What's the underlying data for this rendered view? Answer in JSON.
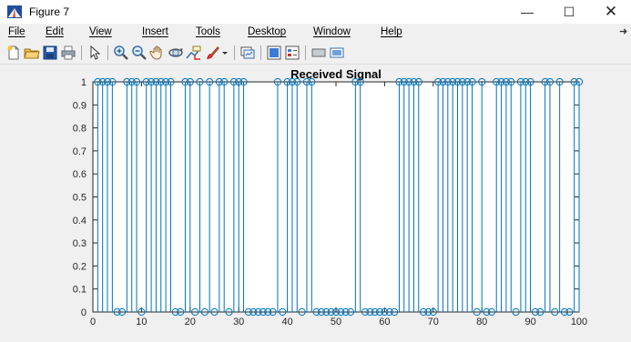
{
  "window": {
    "title": "Figure 7"
  },
  "controls": {
    "minimize": "—",
    "maximize": "☐",
    "close": "✕"
  },
  "menu": [
    "File",
    "Edit",
    "View",
    "Insert",
    "Tools",
    "Desktop",
    "Window",
    "Help"
  ],
  "toolbar": {
    "icons": [
      "new-figure-icon",
      "open-file-icon",
      "save-icon",
      "print-icon",
      "pointer-icon",
      "zoom-in-icon",
      "zoom-out-icon",
      "pan-icon",
      "rotate-3d-icon",
      "data-cursor-icon",
      "brush-icon",
      "brush-dropdown-icon",
      "link-plot-icon",
      "colorbar-icon",
      "legend-icon",
      "hide-plot-tools-icon",
      "show-plot-tools-icon"
    ]
  },
  "colors": {
    "stem": "#0072bd",
    "axes_bg": "#ffffff",
    "figure_bg": "#f0f0f0"
  },
  "chart_data": {
    "type": "stem",
    "title": "Received Signal",
    "xlabel": "",
    "ylabel": "",
    "xlim": [
      0,
      100
    ],
    "ylim": [
      0,
      1
    ],
    "xticks": [
      0,
      10,
      20,
      30,
      40,
      50,
      60,
      70,
      80,
      90,
      100
    ],
    "yticks": [
      0,
      0.1,
      0.2,
      0.3,
      0.4,
      0.5,
      0.6,
      0.7,
      0.8,
      0.9,
      1
    ],
    "grid": false,
    "x": [
      1,
      2,
      3,
      4,
      5,
      6,
      7,
      8,
      9,
      10,
      11,
      12,
      13,
      14,
      15,
      16,
      17,
      18,
      19,
      20,
      21,
      22,
      23,
      24,
      25,
      26,
      27,
      28,
      29,
      30,
      31,
      32,
      33,
      34,
      35,
      36,
      37,
      38,
      39,
      40,
      41,
      42,
      43,
      44,
      45,
      46,
      47,
      48,
      49,
      50,
      51,
      52,
      53,
      54,
      55,
      56,
      57,
      58,
      59,
      60,
      61,
      62,
      63,
      64,
      65,
      66,
      67,
      68,
      69,
      70,
      71,
      72,
      73,
      74,
      75,
      76,
      77,
      78,
      79,
      80,
      81,
      82,
      83,
      84,
      85,
      86,
      87,
      88,
      89,
      90,
      91,
      92,
      93,
      94,
      95,
      96,
      97,
      98,
      99,
      100
    ],
    "values": [
      1,
      1,
      1,
      1,
      0,
      0,
      1,
      1,
      1,
      0,
      1,
      1,
      1,
      1,
      1,
      1,
      0,
      0,
      1,
      1,
      0,
      1,
      0,
      1,
      0,
      1,
      1,
      0,
      1,
      1,
      1,
      0,
      0,
      0,
      0,
      0,
      0,
      1,
      0,
      1,
      1,
      1,
      0,
      1,
      1,
      0,
      0,
      0,
      0,
      0,
      0,
      0,
      0,
      1,
      1,
      0,
      0,
      0,
      0,
      0,
      0,
      0,
      1,
      1,
      1,
      1,
      1,
      0,
      0,
      0,
      1,
      1,
      1,
      1,
      1,
      1,
      1,
      1,
      0,
      1,
      0,
      0,
      1,
      1,
      1,
      1,
      0,
      1,
      1,
      1,
      0,
      0,
      1,
      1,
      0,
      1,
      0,
      0,
      1,
      1
    ]
  }
}
